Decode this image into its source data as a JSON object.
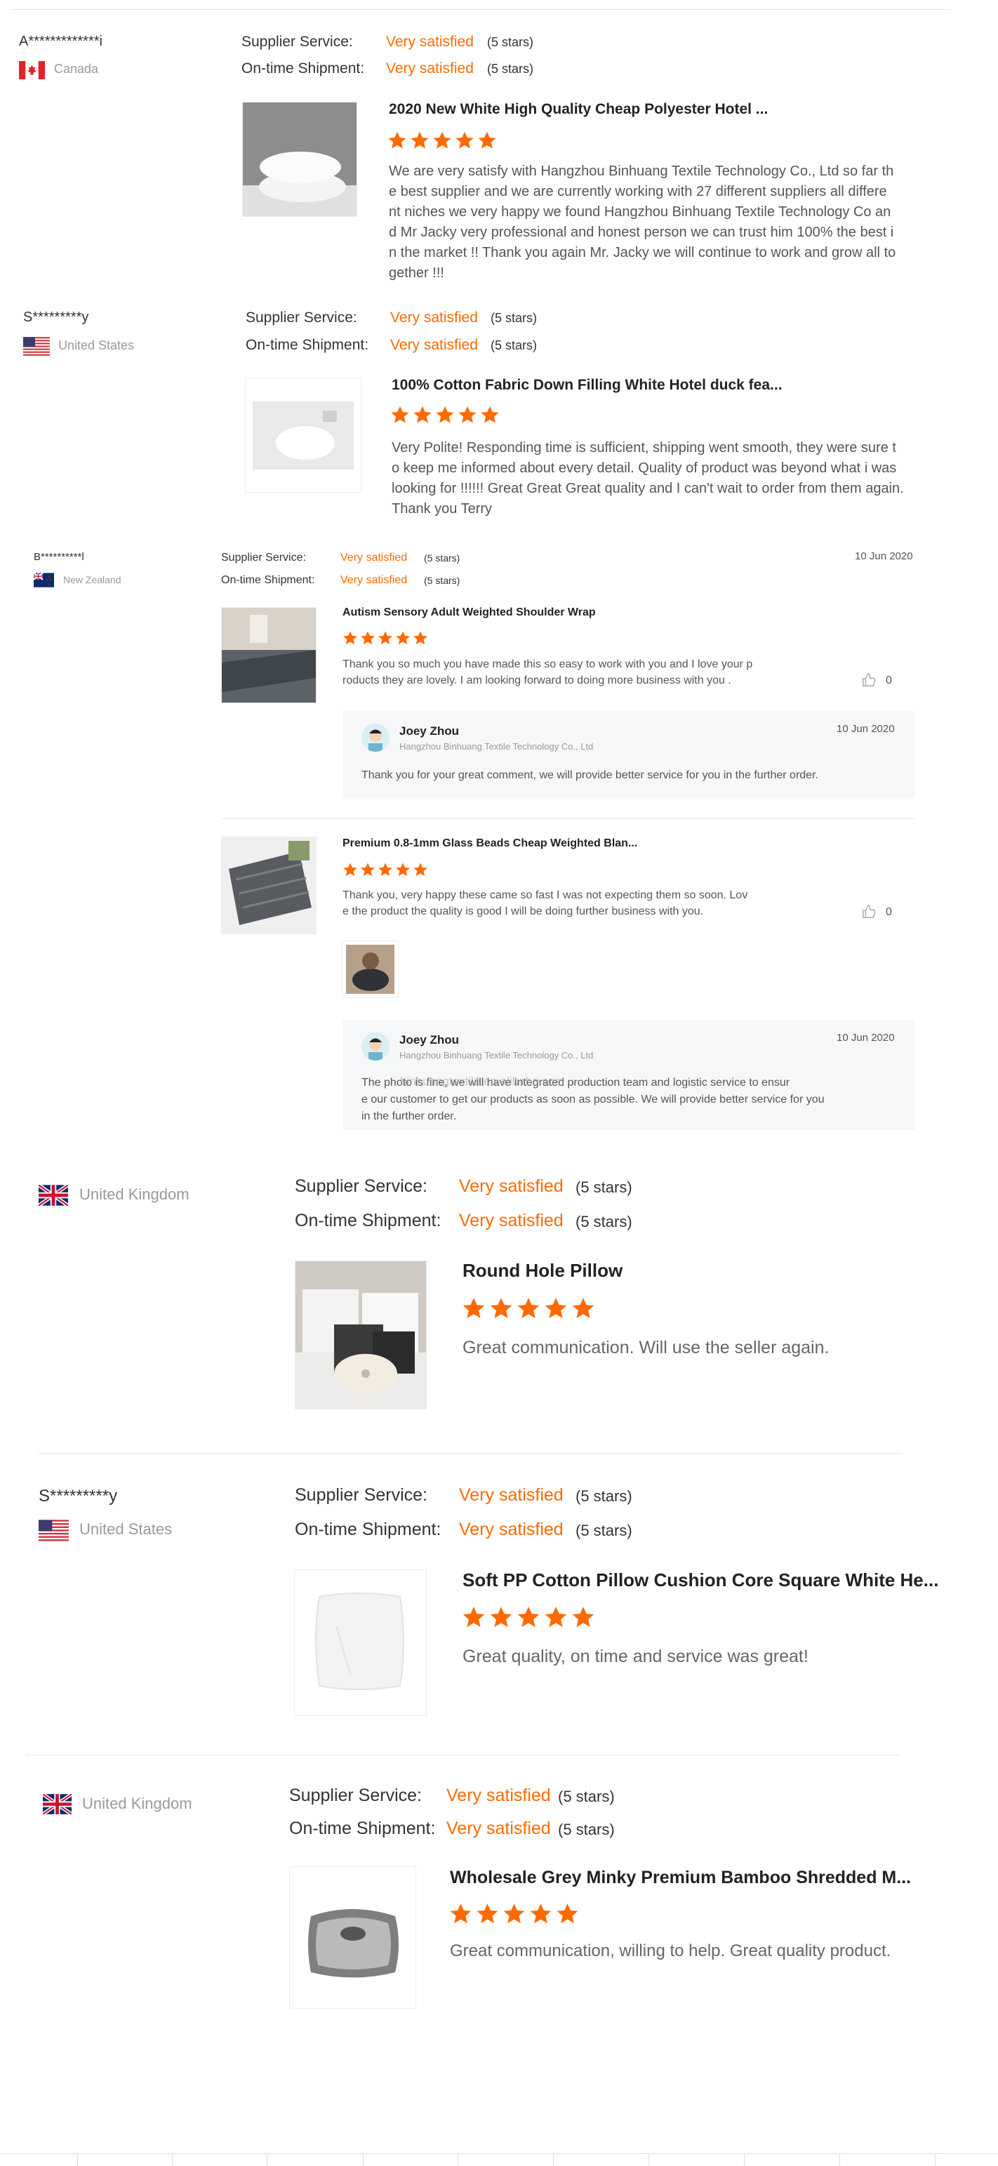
{
  "labels": {
    "supplier_service": "Supplier Service:",
    "on_time_shipment": "On-time Shipment:",
    "very_satisfied": "Very satisfied",
    "five_stars": "(5 stars)"
  },
  "colors": {
    "accent": "#ff6a00",
    "muted": "#999999",
    "reply_bg": "#f6f7f9"
  },
  "reviews": [
    {
      "user": "A*************i",
      "country": "Canada",
      "flag_icon": "canada-flag-icon",
      "product": "2020 New White High Quality Cheap Polyester Hotel ...",
      "rating": 5,
      "comment_lines": [
        "We are very satisfy with Hangzhou Binhuang Textile Technology Co., Ltd so far th",
        "e best supplier and we are currently working with 27 different suppliers all differe",
        "nt niches we very happy we found  Hangzhou Binhuang Textile Technology Co an",
        "d Mr Jacky very professional and honest person we can trust him 100% the best i",
        "n the market !! Thank you again Mr. Jacky we will continue to work and grow all to",
        "gether !!!"
      ]
    },
    {
      "user": "S*********y",
      "country": "United States",
      "flag_icon": "usa-flag-icon",
      "product": "100% Cotton Fabric Down Filling White Hotel duck fea...",
      "rating": 5,
      "comment_lines": [
        "Very Polite! Responding time is sufficient, shipping went smooth, they were sure t",
        "o keep me informed about every detail. Quality of product was beyond what i was",
        "looking for !!!!!! Great Great Great quality and I can't wait to order from them again.",
        "Thank you Terry"
      ]
    },
    {
      "user": "B**********l",
      "country": "New Zealand",
      "flag_icon": "new-zealand-flag-icon",
      "date": "10 Jun 2020",
      "items": [
        {
          "product": "Autism Sensory Adult Weighted Shoulder Wrap",
          "rating": 5,
          "comment_lines": [
            "Thank you so much you have made this so easy to work with you and I love your p",
            "roducts they are lovely. I am looking forward to doing more business with you ."
          ],
          "likes": "0",
          "reply": {
            "name": "Joey Zhou",
            "company": "Hangzhou Binhuang Textile Technology Co., Ltd",
            "date": "10 Jun 2020",
            "text_lines": [
              "Thank you for your great comment, we will provide better service for you in the further order."
            ]
          }
        },
        {
          "product": "Premium 0.8-1mm Glass Beads Cheap Weighted Blan...",
          "rating": 5,
          "comment_lines": [
            "Thank you, very happy these came so fast I was not expecting them so soon. Lov",
            "e the product the quality is good I will be doing further business with you."
          ],
          "likes": "0",
          "reply": {
            "name": "Joey Zhou",
            "company": "Hangzhou Binhuang Textile Technology Co., Ltd",
            "date": "10 Jun 2020",
            "text_lines": [
              "The photo is fine, we will have integrated production team and logistic service to ensur",
              "e our customer  to get our products as soon as possible. We will provide better service for you",
              "in the further order."
            ],
            "overlay": "binhuangtextile.en.alibaba.com"
          }
        }
      ]
    },
    {
      "user": "",
      "country": "United Kingdom",
      "flag_icon": "uk-flag-icon",
      "product": "Round Hole Pillow",
      "rating": 5,
      "comment_lines": [
        "Great communication. Will use the seller again."
      ]
    },
    {
      "user": "S*********y",
      "country": "United States",
      "flag_icon": "usa-flag-icon",
      "product": "Soft PP Cotton Pillow Cushion Core Square White He...",
      "rating": 5,
      "comment_lines": [
        "Great quality, on time and service was great!"
      ]
    },
    {
      "user": "",
      "country": "United Kingdom",
      "flag_icon": "uk-flag-icon",
      "product": "Wholesale Grey Minky Premium Bamboo Shredded M...",
      "rating": 5,
      "comment_lines": [
        "Great communication, willing to help. Great quality product."
      ]
    }
  ]
}
